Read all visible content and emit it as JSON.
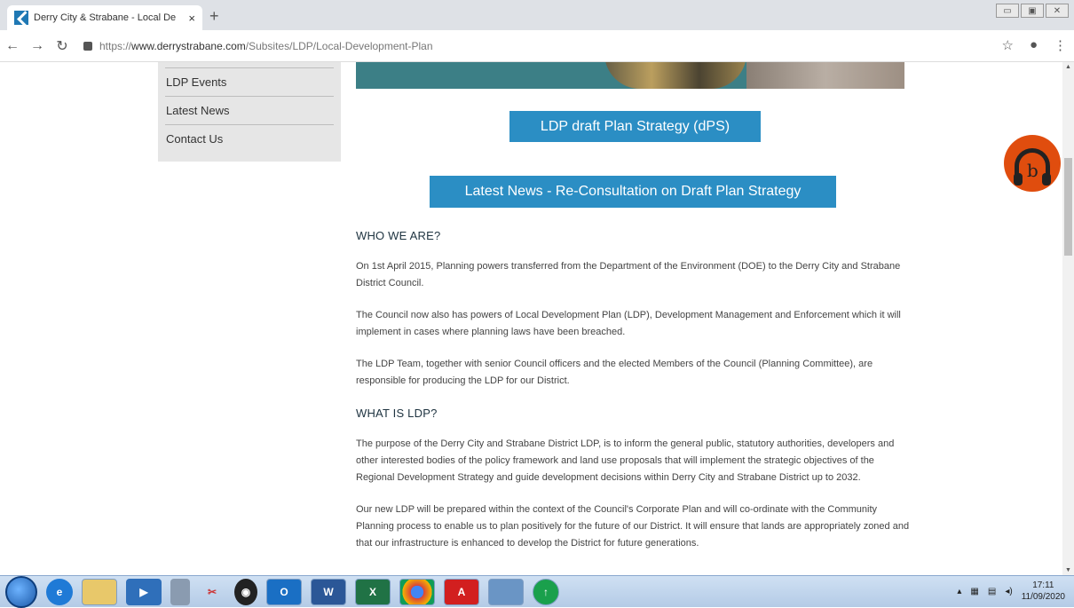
{
  "browser": {
    "tab_title": "Derry City & Strabane - Local De",
    "tab_close": "×",
    "new_tab": "+",
    "url_prefix": "https://",
    "url_domain": "www.derrystrabane.com",
    "url_path": "/Subsites/LDP/Local-Development-Plan",
    "window_controls": [
      "▭",
      "▣",
      "✕"
    ]
  },
  "sidebar": {
    "items": [
      "LDP Events",
      "Latest News",
      "Contact Us"
    ]
  },
  "main": {
    "button1": "LDP draft Plan Strategy (dPS)",
    "button2": "Latest News - Re-Consultation on Draft Plan Strategy",
    "section1_title": "WHO WE ARE?",
    "p1": "On 1st April 2015, Planning powers transferred from the Department of the Environment (DOE) to the Derry City and Strabane District Council.",
    "p2": "The Council now also has powers of Local Development Plan (LDP), Development Management and Enforcement which it will implement in cases where planning laws have been breached.",
    "p3": "The LDP Team, together with senior Council officers and the elected Members of the Council (Planning Committee), are responsible for producing the LDP for our District.",
    "section2_title": "WHAT IS LDP?",
    "p4": "The purpose of the Derry City and Strabane District LDP, is to inform the general public, statutory authorities, developers and other interested bodies of the policy framework and land use proposals that will implement the strategic objectives of the Regional Development Strategy and guide development decisions within Derry City and Strabane District up to 2032.",
    "p5": "Our new LDP will be prepared within the context of the Council's Corporate Plan and will co-ordinate with the Community Planning process to enable us to plan positively for the future of our District. It will ensure that lands are appropriately zoned and that our infrastructure is enhanced to develop the District for future generations."
  },
  "taskbar": {
    "time": "17:11",
    "date": "11/09/2020",
    "icons": [
      "internet-explorer",
      "file-explorer",
      "media-player",
      "calculator",
      "snipping-tool",
      "lock-app",
      "outlook",
      "word",
      "excel",
      "chrome",
      "acrobat",
      "photos",
      "upload"
    ]
  }
}
